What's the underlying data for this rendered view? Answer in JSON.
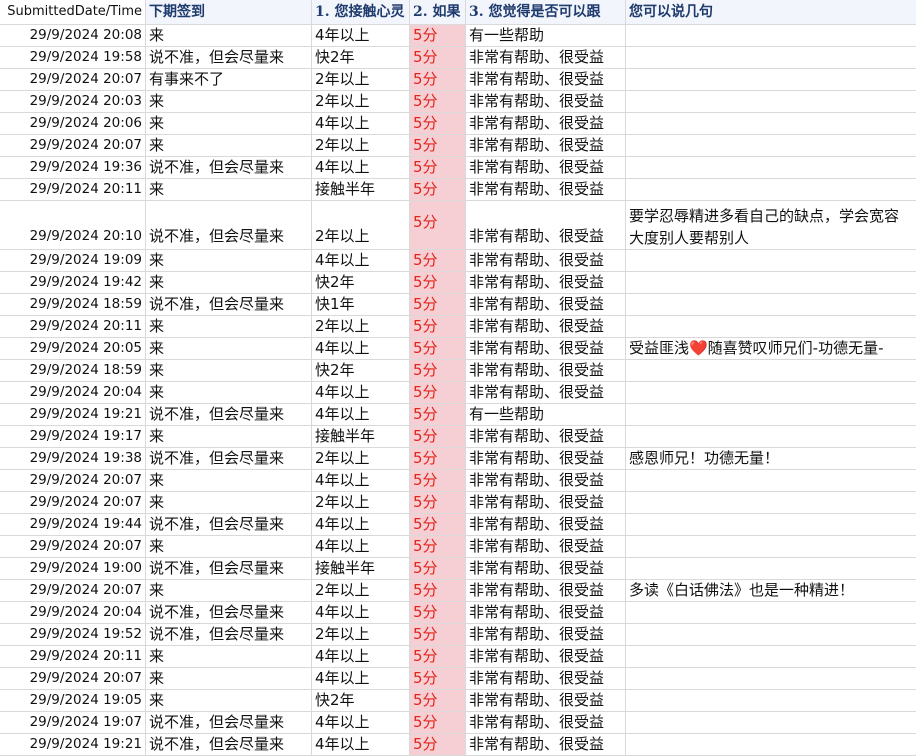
{
  "table": {
    "headers": [
      "SubmittedDate/Time",
      "下期签到",
      "1. 您接触心灵",
      "2. 如果",
      "3. 您觉得是否可以跟",
      "您可以说几句"
    ],
    "rows": [
      {
        "date": "29/9/2024 20:08",
        "signin": "来",
        "duration": "4年以上",
        "score": "5分",
        "help": "有一些帮助",
        "comment": ""
      },
      {
        "date": "29/9/2024 19:58",
        "signin": "说不准，但会尽量来",
        "duration": "快2年",
        "score": "5分",
        "help": "非常有帮助、很受益",
        "comment": ""
      },
      {
        "date": "29/9/2024 20:07",
        "signin": "有事来不了",
        "duration": "2年以上",
        "score": "5分",
        "help": "非常有帮助、很受益",
        "comment": ""
      },
      {
        "date": "29/9/2024 20:03",
        "signin": "来",
        "duration": "2年以上",
        "score": "5分",
        "help": "非常有帮助、很受益",
        "comment": ""
      },
      {
        "date": "29/9/2024 20:06",
        "signin": "来",
        "duration": "4年以上",
        "score": "5分",
        "help": "非常有帮助、很受益",
        "comment": ""
      },
      {
        "date": "29/9/2024 20:07",
        "signin": "来",
        "duration": "2年以上",
        "score": "5分",
        "help": "非常有帮助、很受益",
        "comment": ""
      },
      {
        "date": "29/9/2024 19:36",
        "signin": "说不准，但会尽量来",
        "duration": "4年以上",
        "score": "5分",
        "help": "非常有帮助、很受益",
        "comment": ""
      },
      {
        "date": "29/9/2024 20:11",
        "signin": "来",
        "duration": "接触半年",
        "score": "5分",
        "help": "非常有帮助、很受益",
        "comment": ""
      },
      {
        "date": "29/9/2024 20:10",
        "signin": "说不准，但会尽量来",
        "duration": "2年以上",
        "score": "5分",
        "help": "非常有帮助、很受益",
        "comment": "要学忍辱精进多看自己的缺点，学会宽容大度别人要帮别人",
        "tall": true
      },
      {
        "date": "29/9/2024 19:09",
        "signin": "来",
        "duration": "4年以上",
        "score": "5分",
        "help": "非常有帮助、很受益",
        "comment": ""
      },
      {
        "date": "29/9/2024 19:42",
        "signin": "来",
        "duration": "快2年",
        "score": "5分",
        "help": "非常有帮助、很受益",
        "comment": ""
      },
      {
        "date": "29/9/2024 18:59",
        "signin": "说不准，但会尽量来",
        "duration": "快1年",
        "score": "5分",
        "help": "非常有帮助、很受益",
        "comment": ""
      },
      {
        "date": "29/9/2024 20:11",
        "signin": "来",
        "duration": "2年以上",
        "score": "5分",
        "help": "非常有帮助、很受益",
        "comment": ""
      },
      {
        "date": "29/9/2024 20:05",
        "signin": "来",
        "duration": "4年以上",
        "score": "5分",
        "help": "非常有帮助、很受益",
        "comment": "受益匪浅❤️随喜赞叹师兄们-功德无量-"
      },
      {
        "date": "29/9/2024 18:59",
        "signin": "来",
        "duration": "快2年",
        "score": "5分",
        "help": "非常有帮助、很受益",
        "comment": ""
      },
      {
        "date": "29/9/2024 20:04",
        "signin": "来",
        "duration": "4年以上",
        "score": "5分",
        "help": "非常有帮助、很受益",
        "comment": ""
      },
      {
        "date": "29/9/2024 19:21",
        "signin": "说不准，但会尽量来",
        "duration": "4年以上",
        "score": "5分",
        "help": "有一些帮助",
        "comment": ""
      },
      {
        "date": "29/9/2024 19:17",
        "signin": "来",
        "duration": "接触半年",
        "score": "5分",
        "help": "非常有帮助、很受益",
        "comment": ""
      },
      {
        "date": "29/9/2024 19:38",
        "signin": "说不准，但会尽量来",
        "duration": "2年以上",
        "score": "5分",
        "help": "非常有帮助、很受益",
        "comment": "感恩师兄！功德无量！"
      },
      {
        "date": "29/9/2024 20:07",
        "signin": "来",
        "duration": "4年以上",
        "score": "5分",
        "help": "非常有帮助、很受益",
        "comment": ""
      },
      {
        "date": "29/9/2024 20:07",
        "signin": "来",
        "duration": "2年以上",
        "score": "5分",
        "help": "非常有帮助、很受益",
        "comment": ""
      },
      {
        "date": "29/9/2024 19:44",
        "signin": "说不准，但会尽量来",
        "duration": "4年以上",
        "score": "5分",
        "help": "非常有帮助、很受益",
        "comment": ""
      },
      {
        "date": "29/9/2024 20:07",
        "signin": "来",
        "duration": "4年以上",
        "score": "5分",
        "help": "非常有帮助、很受益",
        "comment": ""
      },
      {
        "date": "29/9/2024 19:00",
        "signin": "说不准，但会尽量来",
        "duration": "接触半年",
        "score": "5分",
        "help": "非常有帮助、很受益",
        "comment": ""
      },
      {
        "date": "29/9/2024 20:07",
        "signin": "来",
        "duration": "2年以上",
        "score": "5分",
        "help": "非常有帮助、很受益",
        "comment": "多读《白话佛法》也是一种精进！"
      },
      {
        "date": "29/9/2024 20:04",
        "signin": "说不准，但会尽量来",
        "duration": "4年以上",
        "score": "5分",
        "help": "非常有帮助、很受益",
        "comment": ""
      },
      {
        "date": "29/9/2024 19:52",
        "signin": "说不准，但会尽量来",
        "duration": "2年以上",
        "score": "5分",
        "help": "非常有帮助、很受益",
        "comment": ""
      },
      {
        "date": "29/9/2024 20:11",
        "signin": "来",
        "duration": "4年以上",
        "score": "5分",
        "help": "非常有帮助、很受益",
        "comment": ""
      },
      {
        "date": "29/9/2024 20:07",
        "signin": "来",
        "duration": "4年以上",
        "score": "5分",
        "help": "非常有帮助、很受益",
        "comment": ""
      },
      {
        "date": "29/9/2024 19:05",
        "signin": "来",
        "duration": "快2年",
        "score": "5分",
        "help": "非常有帮助、很受益",
        "comment": ""
      },
      {
        "date": "29/9/2024 19:07",
        "signin": "说不准，但会尽量来",
        "duration": "4年以上",
        "score": "5分",
        "help": "非常有帮助、很受益",
        "comment": ""
      },
      {
        "date": "29/9/2024 19:21",
        "signin": "说不准，但会尽量来",
        "duration": "4年以上",
        "score": "5分",
        "help": "非常有帮助、很受益",
        "comment": ""
      }
    ]
  }
}
